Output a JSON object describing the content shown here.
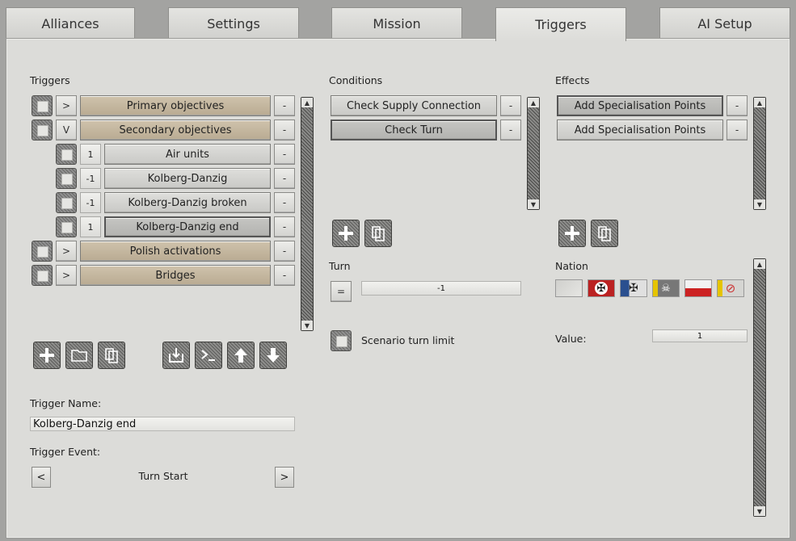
{
  "tabs": [
    "Alliances",
    "Settings",
    "Mission",
    "Triggers",
    "AI Setup"
  ],
  "active_tab": "Triggers",
  "triggers": {
    "heading": "Triggers",
    "rows": [
      {
        "expander": ">",
        "label": "Primary objectives",
        "remove": "-"
      },
      {
        "expander": "V",
        "label": "Secondary objectives",
        "remove": "-"
      },
      {
        "count": "1",
        "label": "Air units",
        "remove": "-"
      },
      {
        "count": "-1",
        "label": "Kolberg-Danzig",
        "remove": "-"
      },
      {
        "count": "-1",
        "label": "Kolberg-Danzig broken",
        "remove": "-"
      },
      {
        "count": "1",
        "label": "Kolberg-Danzig end",
        "remove": "-",
        "selected": true
      },
      {
        "expander": ">",
        "label": "Polish activations",
        "remove": "-"
      },
      {
        "expander": ">",
        "label": "Bridges",
        "remove": "-"
      }
    ],
    "toolbar_icons": [
      "add-icon",
      "folder-icon",
      "copy-icon",
      "import-icon",
      "console-icon",
      "move-up-icon",
      "move-down-icon"
    ]
  },
  "trigger_name": {
    "label": "Trigger Name:",
    "value": "Kolberg-Danzig end"
  },
  "trigger_event": {
    "label": "Trigger Event:",
    "prev": "<",
    "value": "Turn Start",
    "next": ">"
  },
  "conditions": {
    "heading": "Conditions",
    "rows": [
      {
        "label": "Check Supply Connection",
        "remove": "-"
      },
      {
        "label": "Check Turn",
        "remove": "-",
        "selected": true
      }
    ]
  },
  "turn": {
    "label": "Turn",
    "operator": "=",
    "value": "-1",
    "limit_label": "Scenario turn limit"
  },
  "effects": {
    "heading": "Effects",
    "rows": [
      {
        "label": "Add Specialisation Points",
        "remove": "-",
        "selected": true
      },
      {
        "label": "Add Specialisation Points",
        "remove": "-"
      }
    ]
  },
  "nation": {
    "label": "Nation",
    "flags": [
      "blank-flag",
      "german-flag",
      "baltic-cross-flag",
      "ss-skull-flag",
      "polish-flag",
      "none-flag"
    ]
  },
  "value": {
    "label": "Value:",
    "value": "1"
  }
}
